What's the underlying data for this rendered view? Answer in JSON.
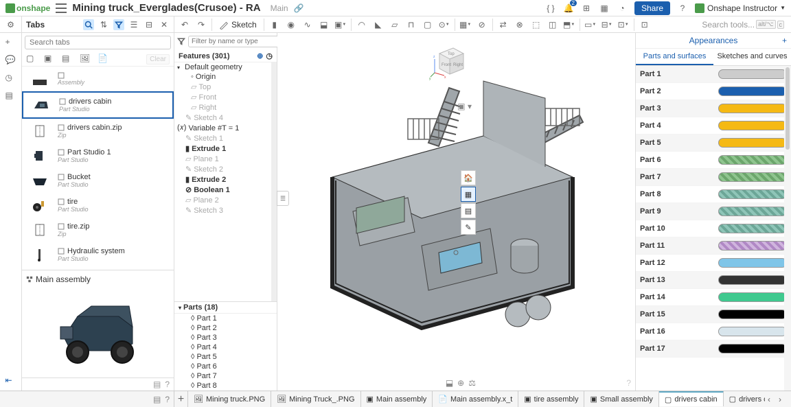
{
  "header": {
    "logo_text": "onshape",
    "doc_title": "Mining truck_Everglades(Crusoe) - RA",
    "branch": "Main",
    "notif_count": "2",
    "share_label": "Share",
    "user_label": "Onshape Instructor"
  },
  "toolbar": {
    "tabs_label": "Tabs",
    "sketch_label": "Sketch",
    "search_placeholder": "Search tools...",
    "kbd1": "alt/⌥",
    "kbd2": "c"
  },
  "search_tabs_placeholder": "Search tabs",
  "clear_label": "Clear",
  "tab_items": [
    {
      "name": "",
      "type": "Assembly",
      "thumb": "asm-partial"
    },
    {
      "name": "drivers cabin",
      "type": "Part Studio",
      "thumb": "cabin",
      "selected": true
    },
    {
      "name": "drivers cabin.zip",
      "type": "Zip",
      "thumb": "zip"
    },
    {
      "name": "Part Studio 1",
      "type": "Part Studio",
      "thumb": "part1"
    },
    {
      "name": "Bucket",
      "type": "Part Studio",
      "thumb": "bucket"
    },
    {
      "name": "tire",
      "type": "Part Studio",
      "thumb": "tire"
    },
    {
      "name": "tire.zip",
      "type": "Zip",
      "thumb": "zip"
    },
    {
      "name": "Hydraulic system",
      "type": "Part Studio",
      "thumb": "hydraulic"
    }
  ],
  "main_assembly": {
    "label": "Main assembly"
  },
  "features": {
    "filter_placeholder": "Filter by name or type",
    "header": "Features (301)",
    "parts_header": "Parts (18)",
    "items": [
      {
        "label": "Default geometry",
        "chevron": "▾",
        "indent": 0
      },
      {
        "label": "Origin",
        "indent": 2,
        "icon": "origin"
      },
      {
        "label": "Top",
        "indent": 2,
        "icon": "plane",
        "muted": true
      },
      {
        "label": "Front",
        "indent": 2,
        "icon": "plane",
        "muted": true
      },
      {
        "label": "Right",
        "indent": 2,
        "icon": "plane",
        "muted": true
      },
      {
        "label": "Sketch 4",
        "indent": 1,
        "icon": "sketch",
        "muted": true
      },
      {
        "label": "Variable #T = 1",
        "indent": 0,
        "icon": "var"
      },
      {
        "label": "Sketch 1",
        "indent": 1,
        "icon": "sketch",
        "muted": true
      },
      {
        "label": "Extrude 1",
        "indent": 1,
        "icon": "extrude",
        "bold": true
      },
      {
        "label": "Plane 1",
        "indent": 1,
        "icon": "plane",
        "muted": true
      },
      {
        "label": "Sketch 2",
        "indent": 1,
        "icon": "sketch",
        "muted": true
      },
      {
        "label": "Extrude 2",
        "indent": 1,
        "icon": "extrude",
        "bold": true
      },
      {
        "label": "Boolean 1",
        "indent": 1,
        "icon": "bool",
        "bold": true
      },
      {
        "label": "Plane 2",
        "indent": 1,
        "icon": "plane",
        "muted": true
      },
      {
        "label": "Sketch 3",
        "indent": 1,
        "icon": "sketch",
        "muted": true
      }
    ],
    "parts": [
      "Part 1",
      "Part 2",
      "Part 3",
      "Part 4",
      "Part 5",
      "Part 6",
      "Part 7",
      "Part 8"
    ]
  },
  "appearances": {
    "title": "Appearances",
    "tab_parts": "Parts and surfaces",
    "tab_sketches": "Sketches and curves",
    "rows": [
      {
        "name": "Part 1",
        "color": "#cccccc"
      },
      {
        "name": "Part 2",
        "color": "#1b5fae"
      },
      {
        "name": "Part 3",
        "color": "#f5b914"
      },
      {
        "name": "Part 4",
        "color": "#f5b914"
      },
      {
        "name": "Part 5",
        "color": "#f5b914"
      },
      {
        "name": "Part 6",
        "hatch": "green"
      },
      {
        "name": "Part 7",
        "hatch": "green"
      },
      {
        "name": "Part 8",
        "hatch": "teal"
      },
      {
        "name": "Part 9",
        "hatch": "teal"
      },
      {
        "name": "Part 10",
        "hatch": "teal"
      },
      {
        "name": "Part 11",
        "hatch": "purple"
      },
      {
        "name": "Part 12",
        "color": "#7fc5e8"
      },
      {
        "name": "Part 13",
        "color": "#333333"
      },
      {
        "name": "Part 14",
        "color": "#3fc98f"
      },
      {
        "name": "Part 15",
        "color": "#000000"
      },
      {
        "name": "Part 16",
        "color": "#d8e5ec"
      },
      {
        "name": "Part 17",
        "color": "#000000"
      }
    ]
  },
  "bottom_tabs": [
    {
      "label": "Mining truck.PNG",
      "icon": "img"
    },
    {
      "label": "Mining Truck_.PNG",
      "icon": "img"
    },
    {
      "label": "Main assembly",
      "icon": "asm"
    },
    {
      "label": "Main assembly.x_t",
      "icon": "file"
    },
    {
      "label": "tire assembly",
      "icon": "asm"
    },
    {
      "label": "Small assembly",
      "icon": "asm"
    },
    {
      "label": "drivers cabin",
      "icon": "ps",
      "active": true
    },
    {
      "label": "drivers cabi",
      "icon": "ps"
    }
  ],
  "view_cube": {
    "top": "Top",
    "front": "Front",
    "right": "Right"
  }
}
